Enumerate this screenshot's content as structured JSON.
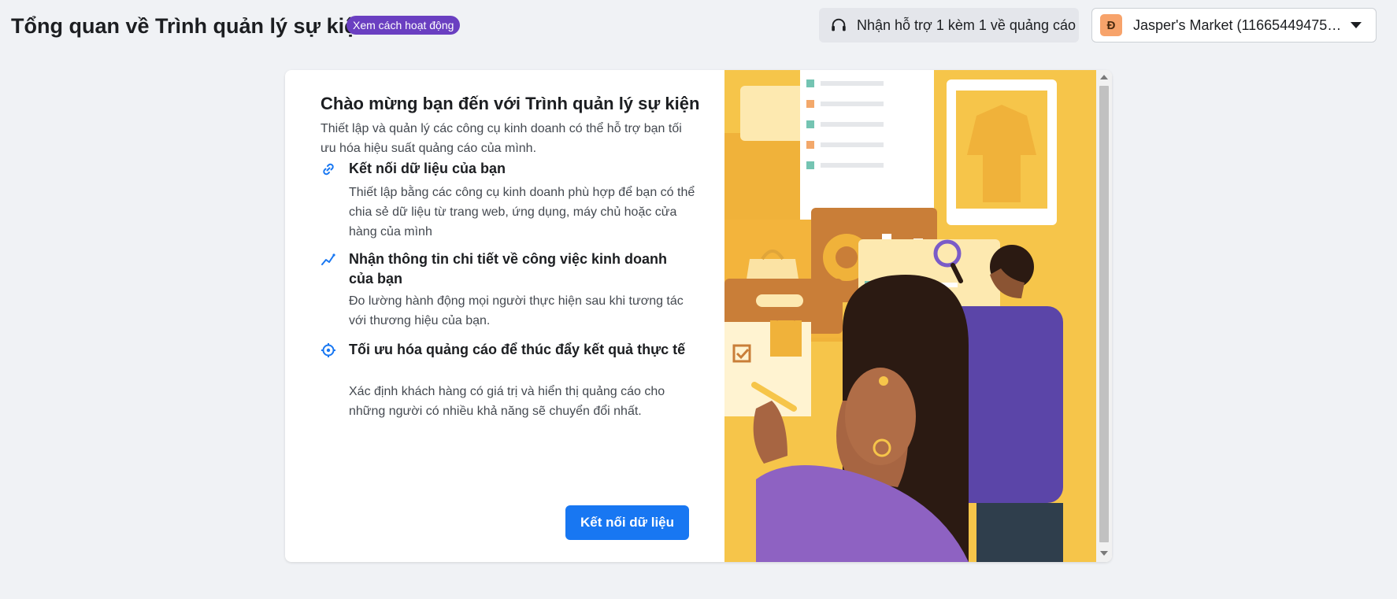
{
  "header": {
    "title": "Tổng quan về Trình quản lý sự kiện",
    "badge": "Xem cách hoạt động",
    "support_label": "Nhận hỗ trợ 1 kèm 1 về quảng cáo",
    "account": {
      "avatar_letter": "Đ",
      "name": "Jasper's Market (116654494758..."
    }
  },
  "welcome": {
    "title": "Chào mừng bạn đến với Trình quản lý sự kiện",
    "subtitle": "Thiết lập và quản lý các công cụ kinh doanh có thể hỗ trợ bạn tối ưu hóa hiệu suất quảng cáo của mình.",
    "features": [
      {
        "icon": "link-icon",
        "title": "Kết nối dữ liệu của bạn",
        "desc": "Thiết lập bằng các công cụ kinh doanh phù hợp để bạn có thể chia sẻ dữ liệu từ trang web, ứng dụng, máy chủ hoặc cửa hàng của mình"
      },
      {
        "icon": "trend-line-icon",
        "title": "Nhận thông tin chi tiết về công việc kinh doanh của bạn",
        "desc": "Đo lường hành động mọi người thực hiện sau khi tương tác với thương hiệu của bạn."
      },
      {
        "icon": "target-icon",
        "title": "Tối ưu hóa quảng cáo để thúc đẩy kết quả thực tế",
        "desc": "Xác định khách hàng có giá trị và hiển thị quảng cáo cho những người có nhiều khả năng sẽ chuyển đổi nhất."
      }
    ],
    "cta_label": "Kết nối dữ liệu"
  },
  "colors": {
    "primary": "#1877f2",
    "badge": "#6a3fc1",
    "illustration_yellow": "#f6c54a"
  }
}
